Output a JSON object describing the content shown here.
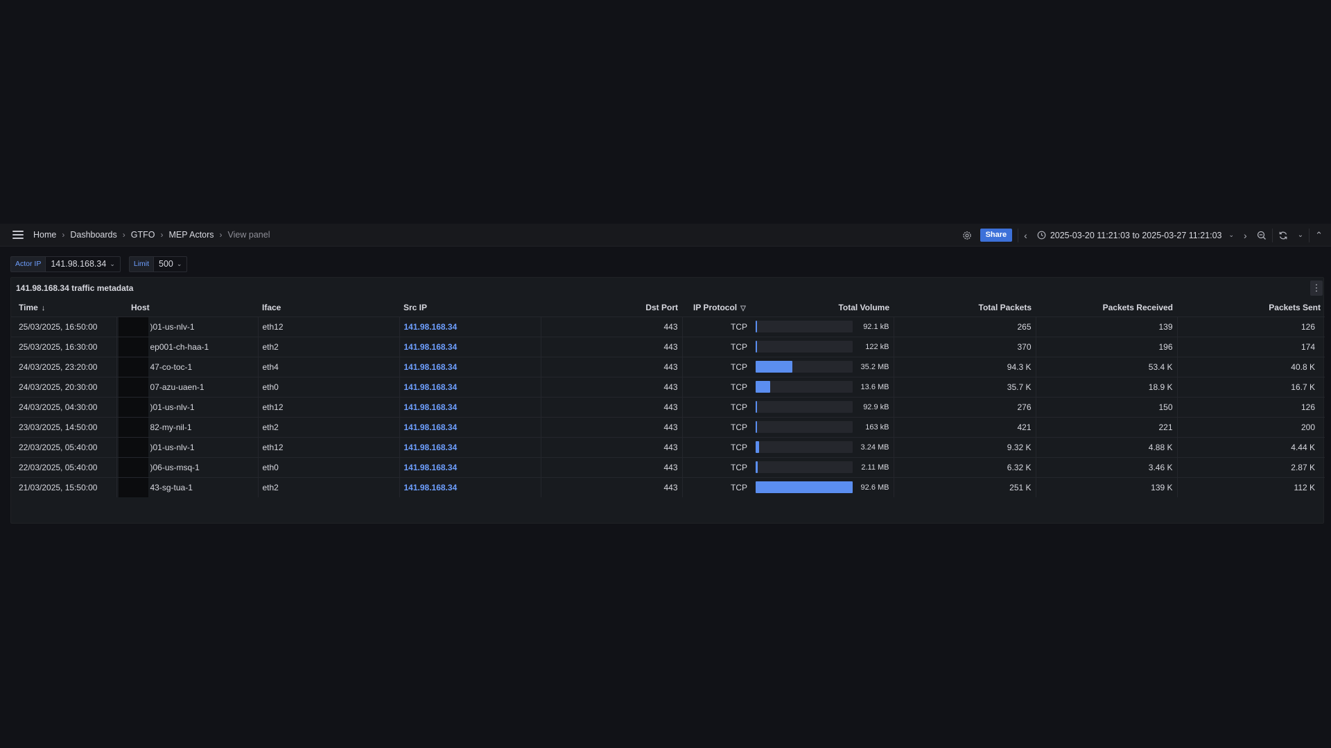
{
  "breadcrumb": [
    "Home",
    "Dashboards",
    "GTFO",
    "MEP Actors",
    "View panel"
  ],
  "toolbar": {
    "share_label": "Share",
    "time_range": "2025-03-20 11:21:03 to 2025-03-27 11:21:03"
  },
  "variables": {
    "actor_ip_label": "Actor IP",
    "actor_ip_value": "141.98.168.34",
    "limit_label": "Limit",
    "limit_value": "500"
  },
  "panel": {
    "title": "141.98.168.34 traffic metadata"
  },
  "table": {
    "columns": [
      "Time",
      "Host",
      "Iface",
      "Src IP",
      "Dst Port",
      "IP Protocol",
      "Total Volume",
      "Total Packets",
      "Packets Received",
      "Packets Sent"
    ],
    "rows": [
      {
        "time": "25/03/2025, 16:50:00",
        "host": ")01-us-nlv-1",
        "iface": "eth12",
        "src_ip": "141.98.168.34",
        "dst_port": "443",
        "protocol": "TCP",
        "volume": "92.1 kB",
        "volume_frac": 0.001,
        "total_packets": "265",
        "received": "139",
        "sent": "126"
      },
      {
        "time": "25/03/2025, 16:30:00",
        "host": "ep001-ch-haa-1",
        "iface": "eth2",
        "src_ip": "141.98.168.34",
        "dst_port": "443",
        "protocol": "TCP",
        "volume": "122 kB",
        "volume_frac": 0.0013,
        "total_packets": "370",
        "received": "196",
        "sent": "174"
      },
      {
        "time": "24/03/2025, 23:20:00",
        "host": "47-co-toc-1",
        "iface": "eth4",
        "src_ip": "141.98.168.34",
        "dst_port": "443",
        "protocol": "TCP",
        "volume": "35.2 MB",
        "volume_frac": 0.38,
        "total_packets": "94.3 K",
        "received": "53.4 K",
        "sent": "40.8 K"
      },
      {
        "time": "24/03/2025, 20:30:00",
        "host": "07-azu-uaen-1",
        "iface": "eth0",
        "src_ip": "141.98.168.34",
        "dst_port": "443",
        "protocol": "TCP",
        "volume": "13.6 MB",
        "volume_frac": 0.147,
        "total_packets": "35.7 K",
        "received": "18.9 K",
        "sent": "16.7 K"
      },
      {
        "time": "24/03/2025, 04:30:00",
        "host": ")01-us-nlv-1",
        "iface": "eth12",
        "src_ip": "141.98.168.34",
        "dst_port": "443",
        "protocol": "TCP",
        "volume": "92.9 kB",
        "volume_frac": 0.001,
        "total_packets": "276",
        "received": "150",
        "sent": "126"
      },
      {
        "time": "23/03/2025, 14:50:00",
        "host": "82-my-nil-1",
        "iface": "eth2",
        "src_ip": "141.98.168.34",
        "dst_port": "443",
        "protocol": "TCP",
        "volume": "163 kB",
        "volume_frac": 0.0018,
        "total_packets": "421",
        "received": "221",
        "sent": "200"
      },
      {
        "time": "22/03/2025, 05:40:00",
        "host": ")01-us-nlv-1",
        "iface": "eth12",
        "src_ip": "141.98.168.34",
        "dst_port": "443",
        "protocol": "TCP",
        "volume": "3.24 MB",
        "volume_frac": 0.035,
        "total_packets": "9.32 K",
        "received": "4.88 K",
        "sent": "4.44 K"
      },
      {
        "time": "22/03/2025, 05:40:00",
        "host": ")06-us-msq-1",
        "iface": "eth0",
        "src_ip": "141.98.168.34",
        "dst_port": "443",
        "protocol": "TCP",
        "volume": "2.11 MB",
        "volume_frac": 0.023,
        "total_packets": "6.32 K",
        "received": "3.46 K",
        "sent": "2.87 K"
      },
      {
        "time": "21/03/2025, 15:50:00",
        "host": "43-sg-tua-1",
        "iface": "eth2",
        "src_ip": "141.98.168.34",
        "dst_port": "443",
        "protocol": "TCP",
        "volume": "92.6 MB",
        "volume_frac": 1.0,
        "total_packets": "251 K",
        "received": "139 K",
        "sent": "112 K"
      }
    ]
  },
  "colors": {
    "accent": "#3d71d9",
    "link": "#6e9fff",
    "bar": "#5b8ef0"
  }
}
